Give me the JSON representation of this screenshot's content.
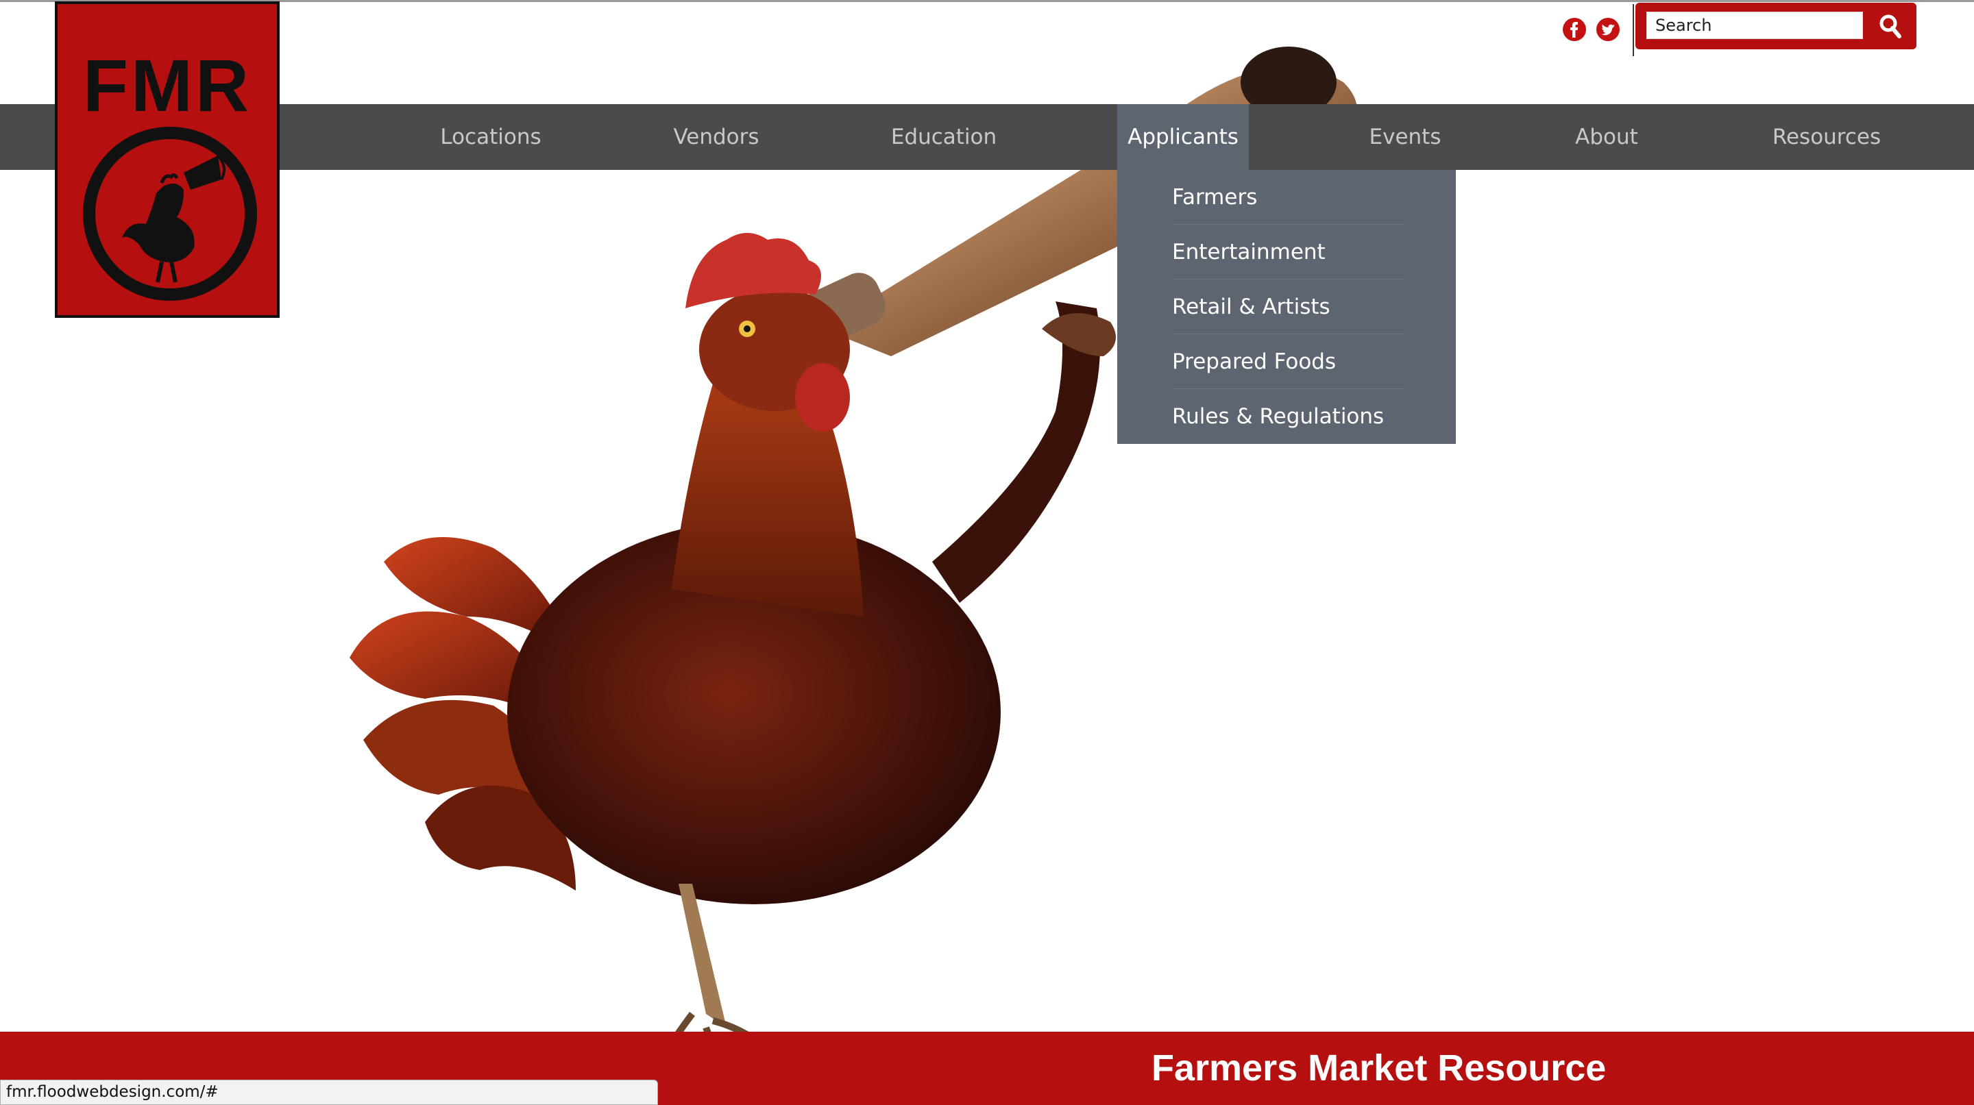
{
  "header": {
    "logo_text": "FMR",
    "social": [
      {
        "icon": "facebook-icon",
        "color": "#c41212"
      },
      {
        "icon": "twitter-icon",
        "color": "#c41212"
      }
    ],
    "search": {
      "placeholder": "Search",
      "value": "Search",
      "icon": "search-icon"
    }
  },
  "nav": {
    "items": [
      {
        "label": "Locations"
      },
      {
        "label": "Vendors"
      },
      {
        "label": "Education"
      },
      {
        "label": "Applicants",
        "active": true
      },
      {
        "label": "Events"
      },
      {
        "label": "About"
      },
      {
        "label": "Resources"
      }
    ]
  },
  "dropdown": {
    "parent": "Applicants",
    "items": [
      {
        "label": "Farmers"
      },
      {
        "label": "Entertainment"
      },
      {
        "label": "Retail & Artists"
      },
      {
        "label": "Prepared Foods"
      },
      {
        "label": "Rules & Regulations"
      }
    ]
  },
  "footer": {
    "title": "Farmers Market Resource"
  },
  "status_bar": {
    "url": "fmr.floodwebdesign.com/#"
  },
  "colors": {
    "brand_red": "#b50f0f",
    "nav_bg": "#4b4b4b",
    "nav_active_bg": "#5c6570",
    "nav_text": "#c9c9c9"
  }
}
